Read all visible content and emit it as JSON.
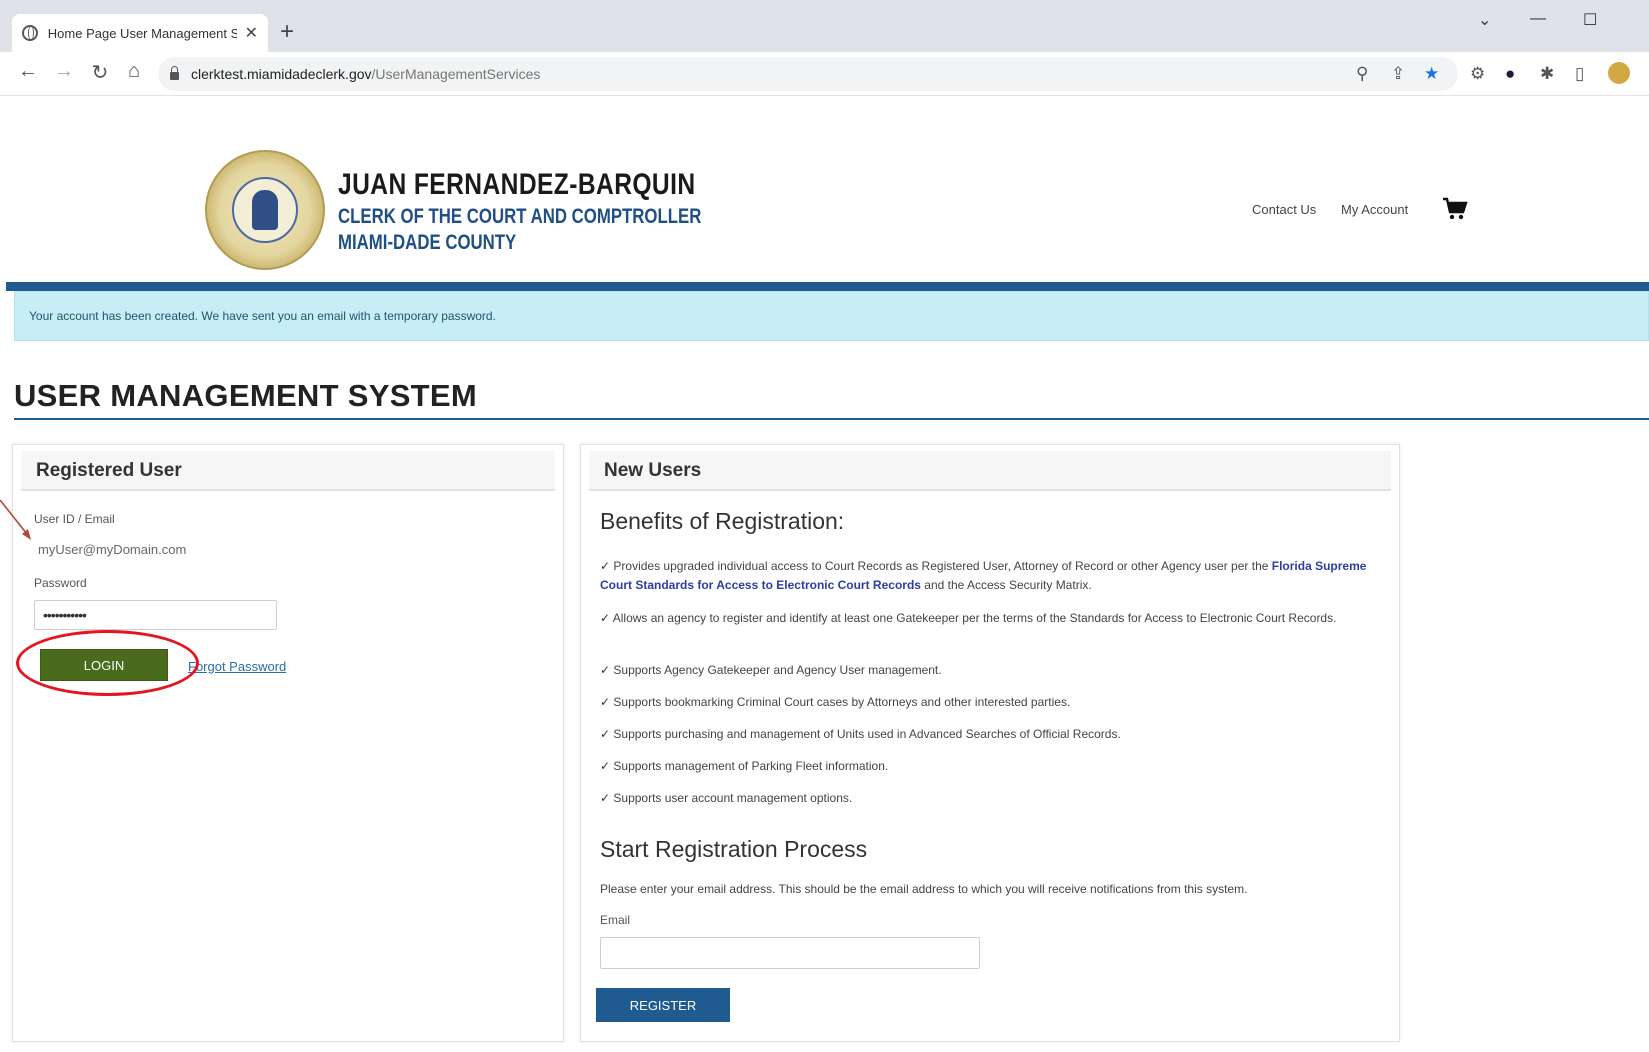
{
  "browser": {
    "tab_title": "Home Page User Management S",
    "tab_close": "✕",
    "new_tab": "+",
    "url_host": "clerktest.miamidadeclerk.gov",
    "url_path": "/UserManagementServices",
    "icons": [
      "back-icon",
      "forward-icon",
      "reload-icon",
      "home-icon",
      "zoom-icon",
      "share-icon",
      "bookmark-star-icon",
      "extension-icon",
      "extension-icon",
      "puzzle-icon",
      "sidebar-icon",
      "profile-avatar"
    ]
  },
  "header": {
    "name": "JUAN FERNANDEZ-BARQUIN",
    "subtitle1": "CLERK OF THE COURT AND COMPTROLLER",
    "subtitle2": "MIAMI-DADE COUNTY",
    "contact_label": "Contact Us",
    "account_label": "My Account"
  },
  "alert": {
    "message": "Your account has been created. We have sent you an email with a temporary password."
  },
  "page_title": "USER MANAGEMENT SYSTEM",
  "registered": {
    "heading": "Registered User",
    "userid_label": "User ID / Email",
    "userid_value": "myUser@myDomain.com",
    "password_label": "Password",
    "password_value": "•••••••••••",
    "login_label": "LOGIN",
    "forgot_label": "Forgot Password"
  },
  "new_users": {
    "heading": "New Users",
    "benefits_title": "Benefits of Registration:",
    "check": "✓",
    "benefit1_pre": " Provides upgraded individual access to Court Records as Registered User, Attorney of Record or other Agency user per the ",
    "benefit1_link": "Florida Supreme Court Standards for Access to Electronic Court Records",
    "benefit1_post": " and the Access Security Matrix.",
    "benefit2": " Allows an agency to register and identify at least one Gatekeeper per the terms of the Standards for Access to Electronic Court Records.",
    "benefit3": " Supports Agency Gatekeeper and Agency User management.",
    "benefit4": " Supports bookmarking Criminal Court cases by Attorneys and other interested parties.",
    "benefit5": " Supports purchasing and management of Units used in Advanced Searches of Official Records.",
    "benefit6": " Supports management of Parking Fleet information.",
    "benefit7": " Supports user account management options.",
    "reg_title": "Start Registration Process",
    "reg_text": "Please enter your email address. This should be the email address to which you will receive notifications from this system.",
    "email_label": "Email",
    "email_value": "",
    "register_label": "REGISTER"
  },
  "colors": {
    "brand_blue": "#1f5b8e",
    "login_green": "#4a6b1c",
    "alert_bg": "#c7eef6",
    "annotation_red": "#e5141f"
  }
}
